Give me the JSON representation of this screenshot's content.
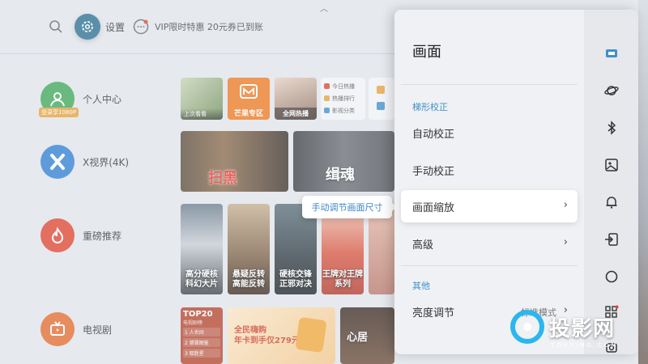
{
  "topbar": {
    "settings_label": "设置",
    "promo_text": "VIP限时特惠 20元券已到账"
  },
  "categories": [
    {
      "label": "个人中心",
      "badge": "登录享1080P",
      "icon": "user-icon",
      "color": "#3fa85a"
    },
    {
      "label": "X视界(4K)",
      "icon": "x-logo-icon",
      "color": "#2f7fd3"
    },
    {
      "label": "重磅推荐",
      "icon": "flame-icon",
      "color": "#e0452f"
    },
    {
      "label": "电视剧",
      "icon": "tv-icon",
      "color": "#e66b2c"
    }
  ],
  "tiles": {
    "row1": {
      "recent_caption": "上次看看",
      "mango_label": "芒果专区",
      "hot_caption": "全网热播",
      "hot_list": [
        "今日热播",
        "热播排行",
        "影视分类"
      ]
    },
    "row2": {
      "movie1_title": "扫黑",
      "movie2_title": "缉魂"
    },
    "row3": {
      "poster1": "高分硬核\n科幻大片",
      "poster2": "悬疑反转\n高能反转",
      "poster3": "硬核交锋\n正邪对决",
      "poster4": "王牌对王牌\n系列"
    },
    "row4": {
      "top20_title": "TOP20",
      "top20_sub": "电视剧榜",
      "top20_items": [
        "1 人世间",
        "2 猎罪图鉴",
        "3 取胜星"
      ],
      "banner_text": "全民嗨购\n年卡到手仅279元",
      "drama_title": "心居"
    }
  },
  "tooltip": "手动调节画面尺寸",
  "panel": {
    "title": "画面",
    "section1": "梯形校正",
    "section2": "其他",
    "items": [
      {
        "label": "自动校正",
        "chevron": false
      },
      {
        "label": "手动校正",
        "chevron": false
      },
      {
        "label": "画面缩放",
        "chevron": true,
        "active": true
      },
      {
        "label": "高级",
        "chevron": true
      },
      {
        "label": "亮度调节",
        "chevron": true,
        "value": "标准模式"
      }
    ],
    "chevron": "›",
    "side_icons": [
      "picture-icon",
      "planet-icon",
      "bluetooth-icon",
      "image-icon",
      "bell-icon",
      "input-source-icon",
      "circle-icon",
      "apps-icon",
      "camera-icon"
    ]
  },
  "watermark": {
    "text": "投影网",
    "sub": "TOUYING.COM"
  },
  "colors": {
    "accent": "#3f8fc9",
    "settings_bg": "#2a6f90",
    "panel_bg": "#eff1f4"
  }
}
